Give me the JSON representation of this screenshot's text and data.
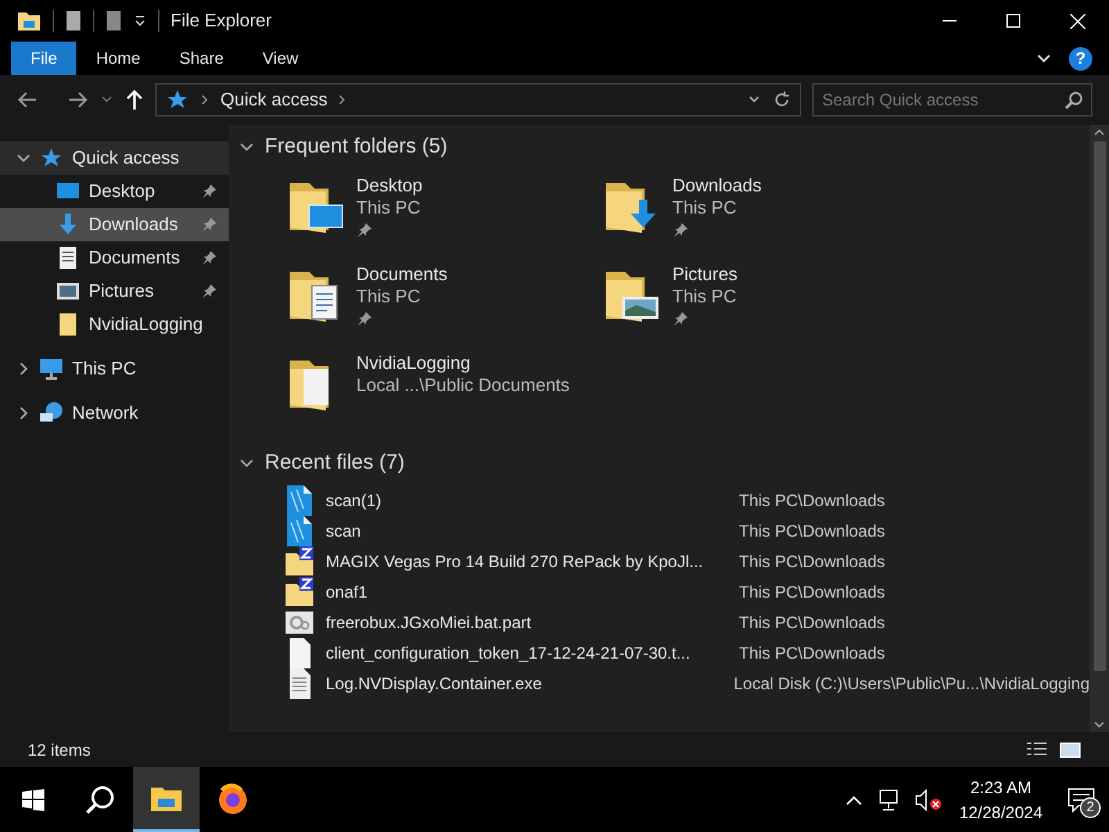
{
  "window": {
    "title": "File Explorer"
  },
  "ribbon_tabs": [
    {
      "label": "File",
      "selected": true
    },
    {
      "label": "Home",
      "selected": false
    },
    {
      "label": "Share",
      "selected": false
    },
    {
      "label": "View",
      "selected": false
    }
  ],
  "help": "?",
  "address": {
    "crumb": "Quick access"
  },
  "search": {
    "placeholder": "Search Quick access"
  },
  "sidebar": {
    "items": [
      {
        "label": "Quick access",
        "kind": "star",
        "expanded": true,
        "selected": false,
        "children": [
          {
            "label": "Desktop",
            "kind": "desktop",
            "pinned": true,
            "selected": false
          },
          {
            "label": "Downloads",
            "kind": "download",
            "pinned": true,
            "selected": true
          },
          {
            "label": "Documents",
            "kind": "document",
            "pinned": true,
            "selected": false
          },
          {
            "label": "Pictures",
            "kind": "picture",
            "pinned": true,
            "selected": false
          },
          {
            "label": "NvidiaLogging",
            "kind": "folder",
            "pinned": false,
            "selected": false
          }
        ]
      },
      {
        "label": "This PC",
        "kind": "pc",
        "expanded": false,
        "selected": false
      },
      {
        "label": "Network",
        "kind": "network",
        "expanded": false,
        "selected": false
      }
    ]
  },
  "frequent": {
    "heading": "Frequent folders (5)",
    "expanded": true,
    "folders": [
      {
        "name": "Desktop",
        "location": "This PC",
        "kind": "desktop",
        "pinned": true
      },
      {
        "name": "Downloads",
        "location": "This PC",
        "kind": "download",
        "pinned": true
      },
      {
        "name": "Documents",
        "location": "This PC",
        "kind": "document",
        "pinned": true
      },
      {
        "name": "Pictures",
        "location": "This PC",
        "kind": "picture",
        "pinned": true
      },
      {
        "name": "NvidiaLogging",
        "location": "Local ...\\Public Documents",
        "kind": "folder",
        "pinned": false
      }
    ]
  },
  "recent": {
    "heading": "Recent files (7)",
    "expanded": true,
    "files": [
      {
        "name": "scan(1)",
        "location": "This PC\\Downloads",
        "kind": "video"
      },
      {
        "name": "scan",
        "location": "This PC\\Downloads",
        "kind": "video"
      },
      {
        "name": "MAGIX Vegas Pro 14 Build 270 RePack by KpoJl...",
        "location": "This PC\\Downloads",
        "kind": "archive"
      },
      {
        "name": "onaf1",
        "location": "This PC\\Downloads",
        "kind": "archive"
      },
      {
        "name": "freerobux.JGxoMiei.bat.part",
        "location": "This PC\\Downloads",
        "kind": "gear"
      },
      {
        "name": "client_configuration_token_17-12-24-21-07-30.t...",
        "location": "This PC\\Downloads",
        "kind": "blank"
      },
      {
        "name": "Log.NVDisplay.Container.exe",
        "location": "Local Disk (C:)\\Users\\Public\\Pu...\\NvidiaLogging",
        "kind": "text"
      }
    ]
  },
  "status_bar": {
    "count": "12 items"
  },
  "taskbar": {
    "apps": [
      {
        "kind": "explorer",
        "selected": true
      },
      {
        "kind": "firefox",
        "selected": false
      }
    ],
    "time": "2:23 AM",
    "date": "12/28/2024",
    "notifications": "2"
  }
}
